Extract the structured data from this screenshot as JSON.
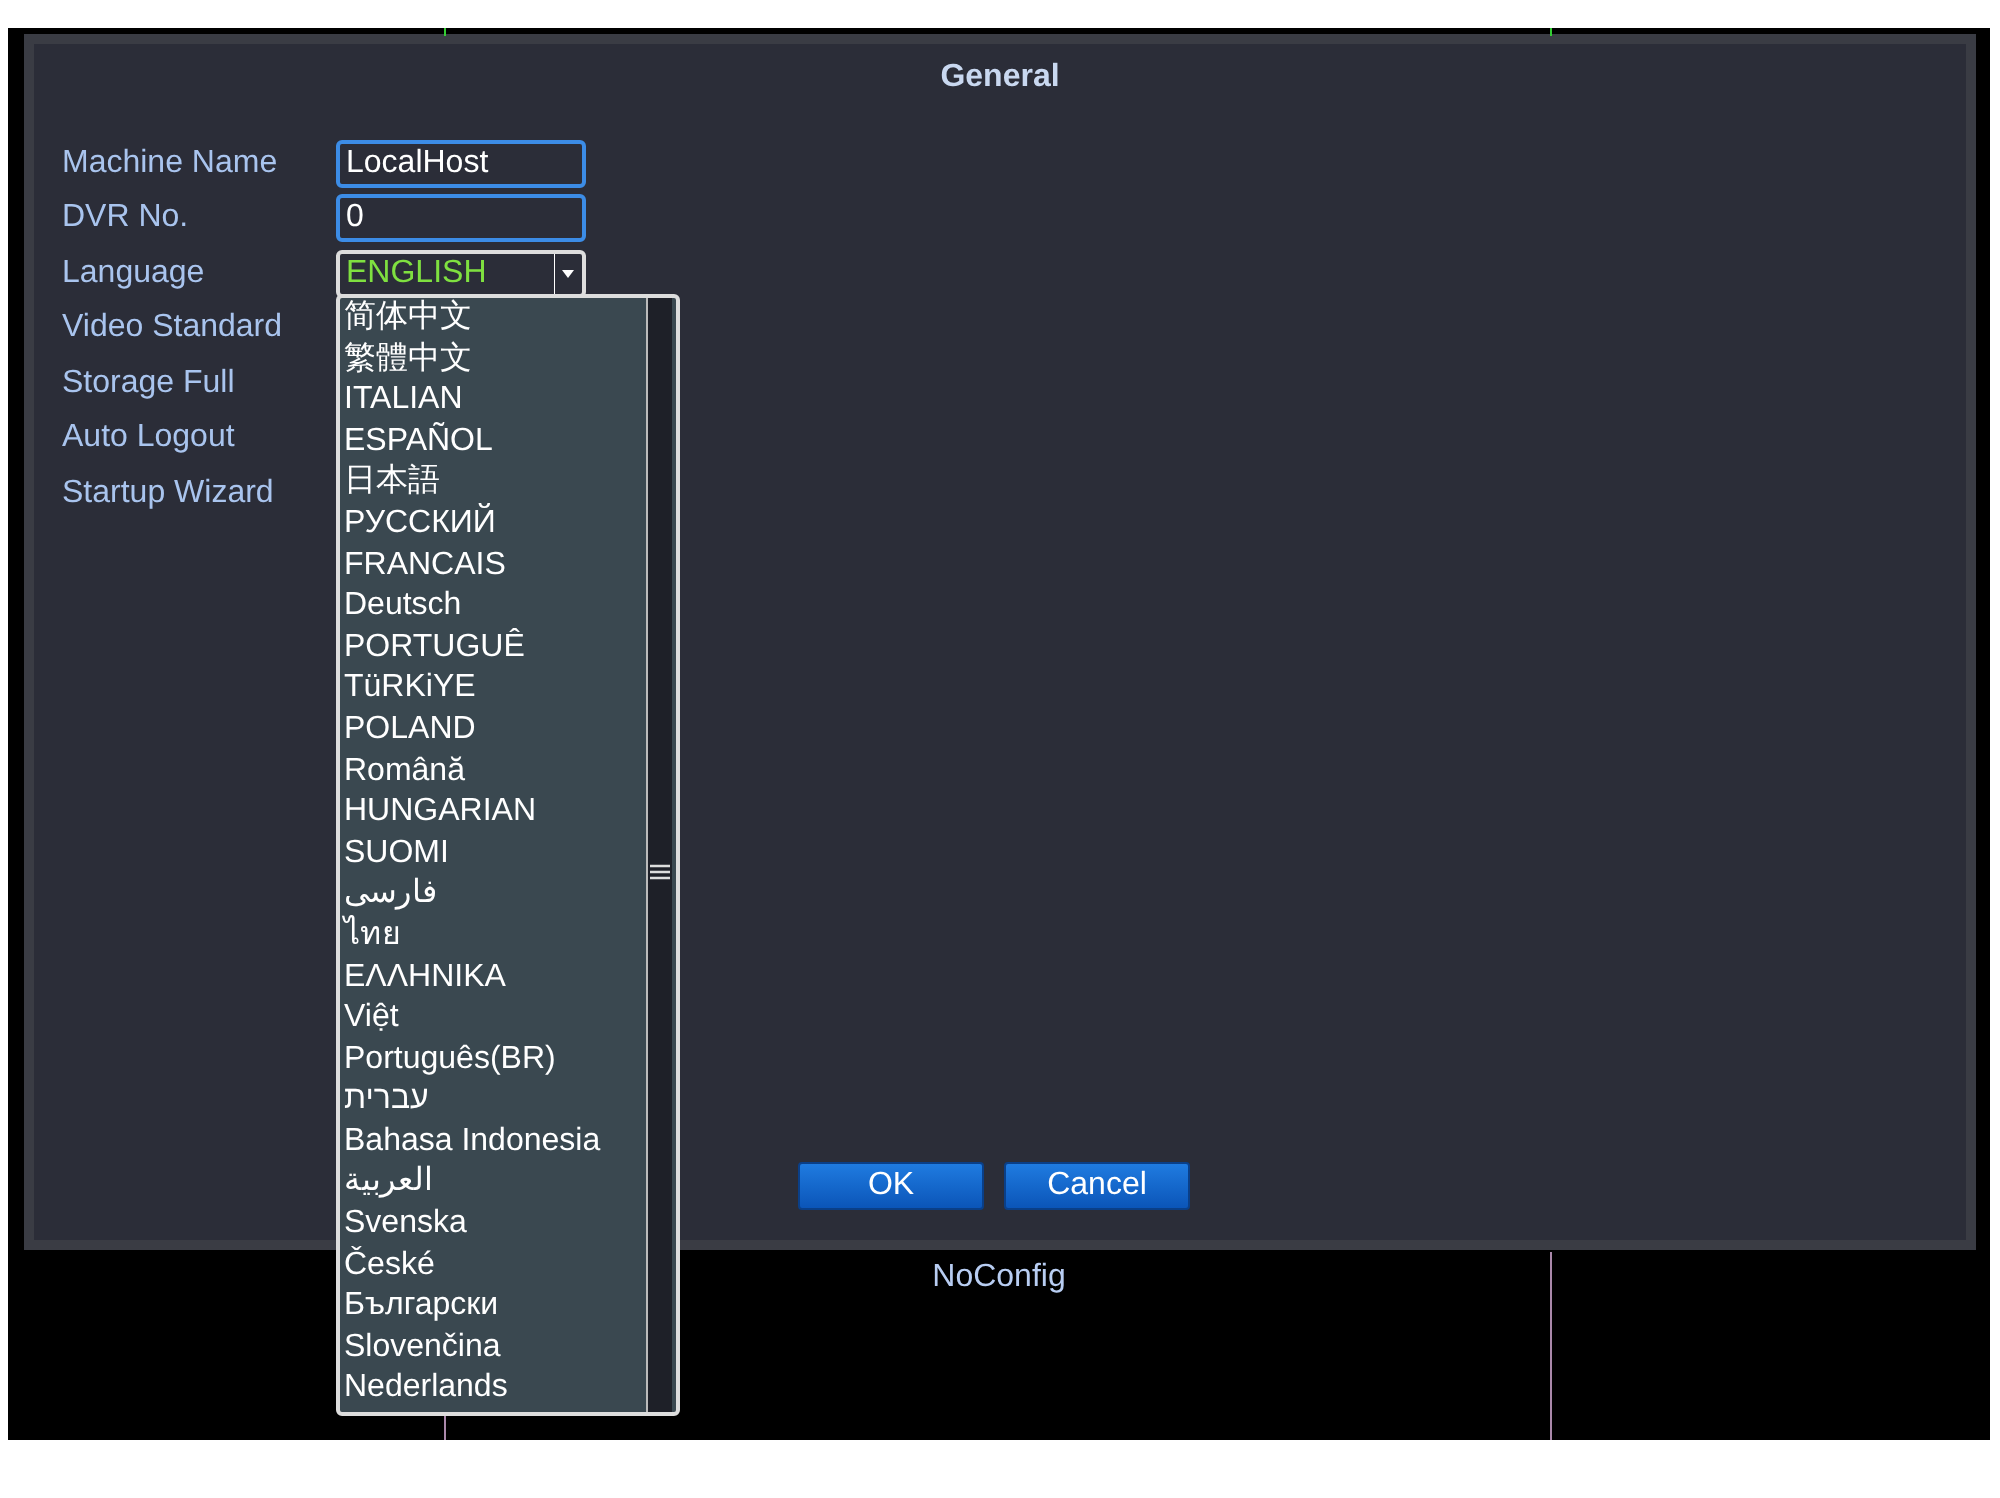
{
  "dialog": {
    "title": "General",
    "rows": [
      {
        "label": "Machine Name",
        "kind": "text",
        "value": "LocalHost"
      },
      {
        "label": "DVR No.",
        "kind": "text",
        "value": "0"
      },
      {
        "label": "Language",
        "kind": "select",
        "value": "ENGLISH"
      },
      {
        "label": "Video Standard",
        "kind": "label"
      },
      {
        "label": "Storage Full",
        "kind": "label"
      },
      {
        "label": "Auto Logout",
        "kind": "label"
      },
      {
        "label": "Startup Wizard",
        "kind": "label"
      }
    ],
    "buttons": [
      "OK",
      "Cancel"
    ]
  },
  "language_list": [
    "简体中文",
    "繁體中文",
    "ITALIAN",
    "ESPAÑOL",
    "日本語",
    "РУССКИЙ",
    "FRANCAIS",
    "Deutsch",
    "PORTUGUÊ",
    "TüRKiYE",
    "POLAND",
    "Română",
    "HUNGARIAN",
    "SUOMI",
    "فارسی",
    "ไทย",
    "ΕΛΛΗΝΙΚΑ",
    "Việt",
    "Português(BR)",
    "עברית",
    "Bahasa Indonesia",
    "العربية",
    "Svenska",
    "České",
    "Български",
    "Slovenčina",
    "Nederlands"
  ],
  "status": "NoConfig"
}
